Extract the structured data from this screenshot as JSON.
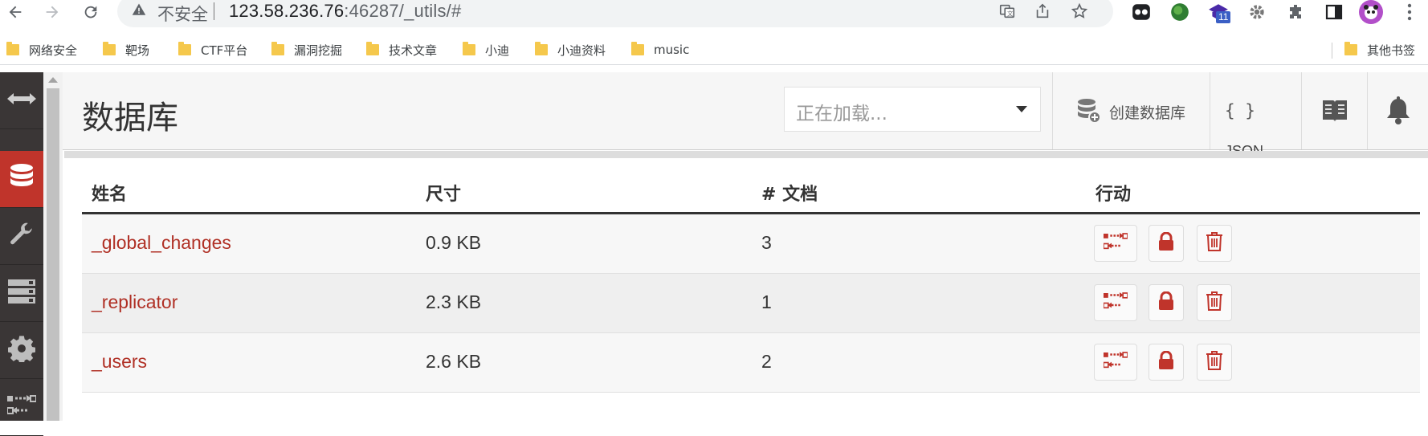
{
  "browser": {
    "insecure_label": "不安全",
    "url_host": "123.58.236.76",
    "url_rest": ":46287/_utils/#",
    "extension_badge": "11",
    "bookmarks": [
      "网络安全",
      "靶场",
      "CTF平台",
      "漏洞挖掘",
      "技术文章",
      "小迪",
      "小迪资料",
      "music"
    ],
    "other_bookmarks": "其他书签"
  },
  "header": {
    "title": "数据库",
    "select_text": "正在加载...",
    "create_db_label": "创建数据库",
    "json_braces": "{ }",
    "json_label": "JSON"
  },
  "table": {
    "columns": [
      "姓名",
      "尺寸",
      "# 文档",
      "行动"
    ],
    "rows": [
      {
        "name": "_global_changes",
        "size": "0.9 KB",
        "docs": "3"
      },
      {
        "name": "_replicator",
        "size": "2.3 KB",
        "docs": "1"
      },
      {
        "name": "_users",
        "size": "2.6 KB",
        "docs": "2"
      }
    ]
  },
  "colors": {
    "accent": "#c0342b",
    "link": "#b03025",
    "sidebar_bg": "#3a3636"
  },
  "icons": {
    "sidebar": [
      "expand-arrows-icon",
      "database-icon",
      "wrench-icon",
      "server-icon",
      "gear-icon",
      "replicate-icon"
    ],
    "row_actions": [
      "replicate-icon",
      "lock-icon",
      "trash-icon"
    ]
  }
}
